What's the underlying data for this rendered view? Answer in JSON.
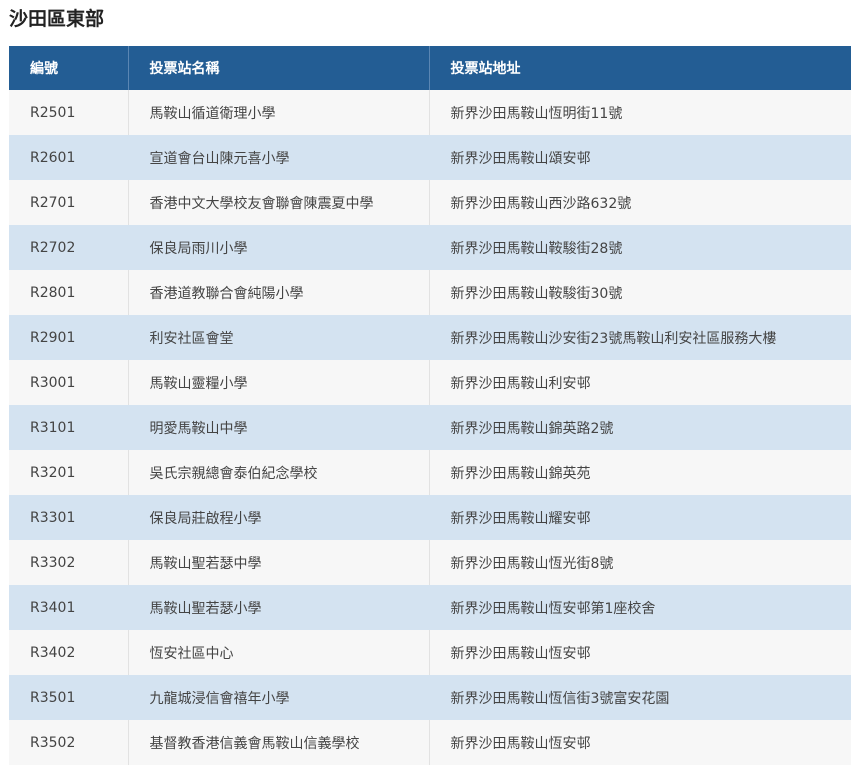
{
  "page": {
    "title": "沙田區東部"
  },
  "table": {
    "headers": [
      "編號",
      "投票站名稱",
      "投票站地址"
    ],
    "rows": [
      [
        "R2501",
        "馬鞍山循道衛理小學",
        "新界沙田馬鞍山恆明街11號"
      ],
      [
        "R2601",
        "宣道會台山陳元喜小學",
        "新界沙田馬鞍山頌安邨"
      ],
      [
        "R2701",
        "香港中文大學校友會聯會陳震夏中學",
        "新界沙田馬鞍山西沙路632號"
      ],
      [
        "R2702",
        "保良局雨川小學",
        "新界沙田馬鞍山鞍駿街28號"
      ],
      [
        "R2801",
        "香港道教聯合會純陽小學",
        "新界沙田馬鞍山鞍駿街30號"
      ],
      [
        "R2901",
        "利安社區會堂",
        "新界沙田馬鞍山沙安街23號馬鞍山利安社區服務大樓"
      ],
      [
        "R3001",
        "馬鞍山靈糧小學",
        "新界沙田馬鞍山利安邨"
      ],
      [
        "R3101",
        "明愛馬鞍山中學",
        "新界沙田馬鞍山錦英路2號"
      ],
      [
        "R3201",
        "吳氏宗親總會泰伯紀念學校",
        "新界沙田馬鞍山錦英苑"
      ],
      [
        "R3301",
        "保良局莊啟程小學",
        "新界沙田馬鞍山耀安邨"
      ],
      [
        "R3302",
        "馬鞍山聖若瑟中學",
        "新界沙田馬鞍山恆光街8號"
      ],
      [
        "R3401",
        "馬鞍山聖若瑟小學",
        "新界沙田馬鞍山恆安邨第1座校舍"
      ],
      [
        "R3402",
        "恆安社區中心",
        "新界沙田馬鞍山恆安邨"
      ],
      [
        "R3501",
        "九龍城浸信會禧年小學",
        "新界沙田馬鞍山恆信街3號富安花園"
      ],
      [
        "R3502",
        "基督教香港信義會馬鞍山信義學校",
        "新界沙田馬鞍山恆安邨"
      ]
    ]
  },
  "colors": {
    "header_bg": "#235d94",
    "row_odd_bg": "#f7f7f7",
    "row_even_bg": "#d4e3f1"
  }
}
